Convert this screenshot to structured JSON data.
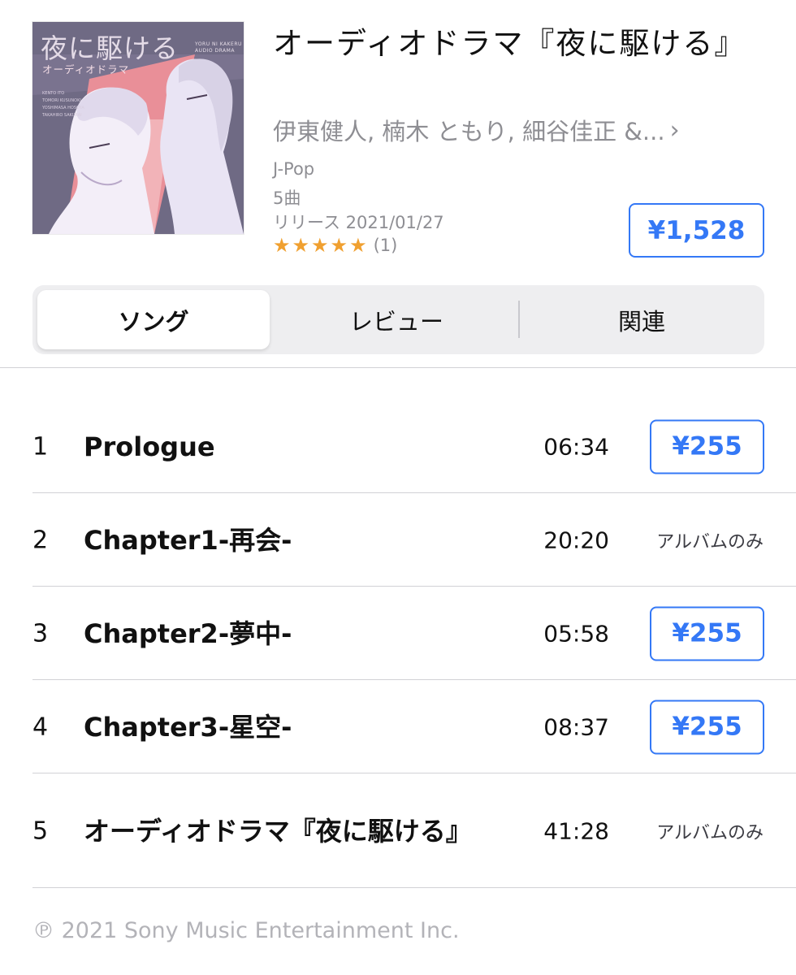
{
  "album": {
    "cover": {
      "title": "夜に駆ける",
      "subtitle": "オーディオドラマ",
      "romaji": [
        "YORU NI KAKERU",
        "AUDIO DRAMA"
      ],
      "credits": [
        "KENTO ITO",
        "TOMORI KUSUNOKI",
        "YOSHIMASA HOSOYA",
        "TAKAHIRO SAKURAI"
      ]
    },
    "title": "オーディオドラマ『夜に駆ける』",
    "artist": "伊東健人, 楠木 ともり, 細谷佳正 &...",
    "artist_chevron": "›",
    "genre": "J-Pop",
    "track_count": "5曲",
    "release": "リリース 2021/01/27",
    "rating_stars": 5,
    "rating_count": "(1)",
    "price": "¥1,528"
  },
  "tabs": [
    {
      "label": "ソング",
      "selected": true
    },
    {
      "label": "レビュー",
      "selected": false
    },
    {
      "label": "関連",
      "selected": false
    }
  ],
  "tracks": [
    {
      "number": "1",
      "title": "Prologue",
      "duration": "06:34",
      "price": "¥255",
      "album_only": null
    },
    {
      "number": "2",
      "title": "Chapter1-再会-",
      "duration": "20:20",
      "price": null,
      "album_only": "アルバムのみ"
    },
    {
      "number": "3",
      "title": "Chapter2-夢中-",
      "duration": "05:58",
      "price": "¥255",
      "album_only": null
    },
    {
      "number": "4",
      "title": "Chapter3-星空-",
      "duration": "08:37",
      "price": "¥255",
      "album_only": null
    },
    {
      "number": "5",
      "title": "オーディオドラマ『夜に駆ける』",
      "duration": "41:28",
      "price": null,
      "album_only": "アルバムのみ"
    }
  ],
  "copyright": "℗ 2021 Sony Music Entertainment Inc.",
  "colors": {
    "accent": "#3478f6",
    "star": "#f0a030",
    "secondary_text": "#8e8e93"
  }
}
